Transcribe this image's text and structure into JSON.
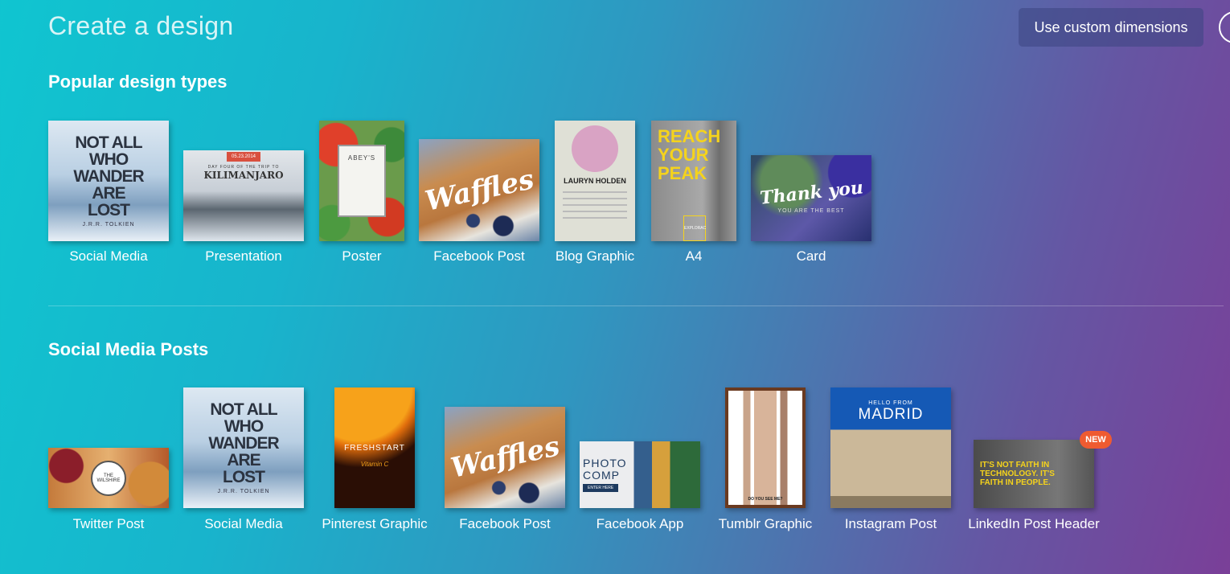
{
  "header": {
    "title": "Create a design",
    "custom_dimensions_button": "Use custom dimensions",
    "help_icon": "?"
  },
  "sections": [
    {
      "title": "Popular design types",
      "items": [
        {
          "label": "Social Media",
          "thumb_text": "NOT ALL WHO WANDER ARE LOST",
          "thumb_sub": "J.R.R. TOLKIEN"
        },
        {
          "label": "Presentation",
          "thumb_date": "05.23.2014",
          "thumb_text": "KILIMANJARO",
          "thumb_sub": "DAY FOUR OF THE TRIP TO"
        },
        {
          "label": "Poster",
          "thumb_text": "ABEY'S"
        },
        {
          "label": "Facebook Post",
          "thumb_text": "Waffles"
        },
        {
          "label": "Blog Graphic",
          "thumb_text": "LAURYN HOLDEN"
        },
        {
          "label": "A4",
          "thumb_text": "REACH YOUR PEAK",
          "thumb_sub": "EXPLORAC"
        },
        {
          "label": "Card",
          "thumb_text": "Thank you",
          "thumb_sub": "YOU ARE THE BEST"
        }
      ]
    },
    {
      "title": "Social Media Posts",
      "items": [
        {
          "label": "Twitter Post",
          "thumb_text": "THE WILSHIRE"
        },
        {
          "label": "Social Media",
          "thumb_text": "NOT ALL WHO WANDER ARE LOST",
          "thumb_sub": "J.R.R. TOLKIEN"
        },
        {
          "label": "Pinterest Graphic",
          "thumb_text": "FRESHSTART",
          "thumb_sub": "Vitamin C"
        },
        {
          "label": "Facebook Post",
          "thumb_text": "Waffles"
        },
        {
          "label": "Facebook App",
          "thumb_text": "PHOTO COMP",
          "thumb_sub": "ENTER HERE"
        },
        {
          "label": "Tumblr Graphic",
          "thumb_sub": "DO YOU SEE ME?"
        },
        {
          "label": "Instagram Post",
          "thumb_sub": "HELLO FROM",
          "thumb_text": "MADRID"
        },
        {
          "label": "LinkedIn Post Header",
          "thumb_text": "IT'S NOT FAITH IN TECHNOLOGY. IT'S FAITH IN PEOPLE.",
          "badge": "NEW"
        }
      ]
    }
  ],
  "colors": {
    "gradient_start": "#10c5d0",
    "gradient_end": "#7a3f98",
    "badge": "#ef5b31",
    "accent_yellow": "#f5d31c"
  }
}
